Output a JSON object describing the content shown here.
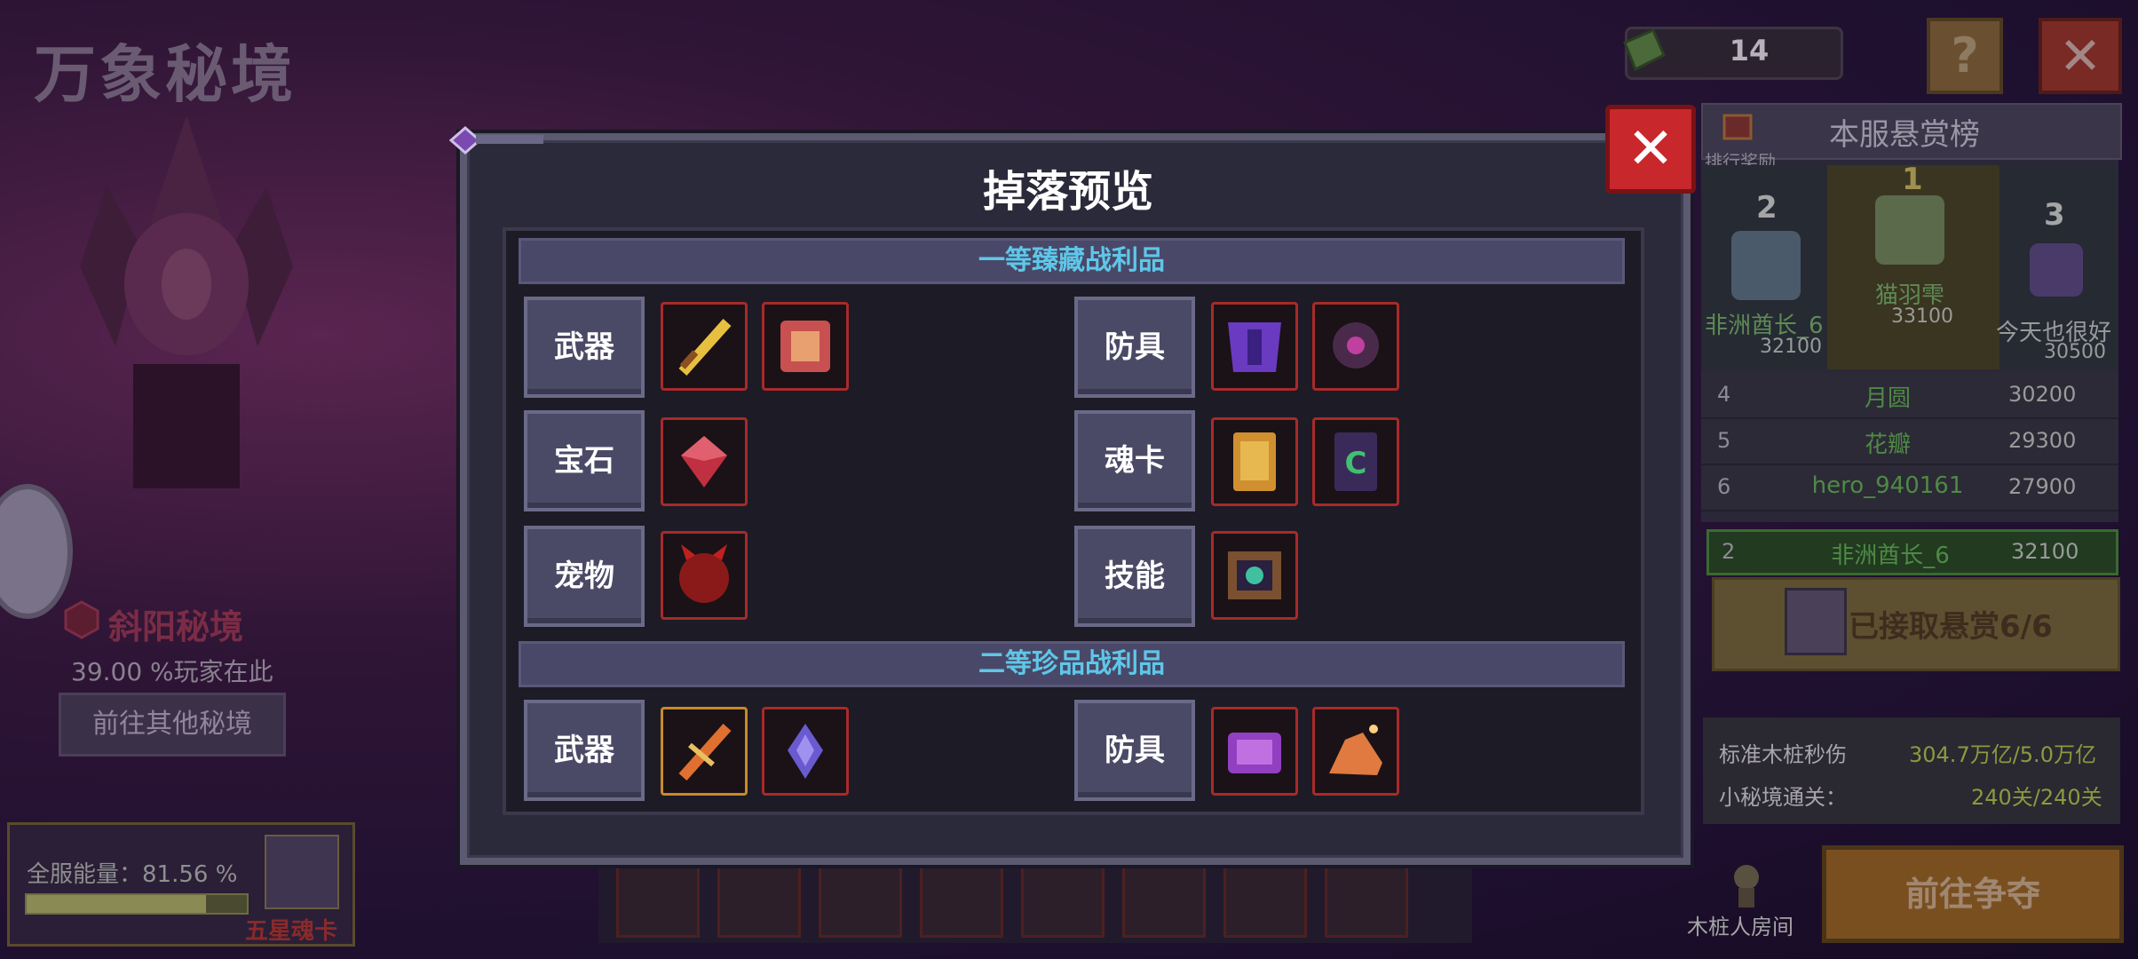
{
  "background": {
    "title": "万象秘境",
    "realm_name": "斜阳秘境",
    "realm_pct": "39.00 %玩家在此",
    "go_other_label": "前往其他秘境",
    "energy_label": "全服能量：81.56 %",
    "energy_fraction": 0.8156,
    "five_star_label": "五星魂卡"
  },
  "hud": {
    "currency_value": "14",
    "help_label": "?",
    "close_label": "✕"
  },
  "leaderboard": {
    "title": "本服悬赏榜",
    "rank_reward": "排行奖励",
    "podium": [
      {
        "rank": "2",
        "name": "非洲酋长_6",
        "score": "32100"
      },
      {
        "rank": "1",
        "name": "猫羽雫",
        "score": "33100"
      },
      {
        "rank": "3",
        "name": "今天也很好",
        "score": "30500"
      }
    ],
    "rows": [
      {
        "rank": "4",
        "name": "月圆",
        "score": "30200"
      },
      {
        "rank": "5",
        "name": "花瓣",
        "score": "29300"
      },
      {
        "rank": "6",
        "name": "hero_940161",
        "score": "27900"
      }
    ],
    "my_row": {
      "rank": "2",
      "name": "非洲酋长_6",
      "score": "32100"
    },
    "bounty_label": "已接取悬赏6/6",
    "stats": [
      {
        "label": "标准木桩秒伤",
        "value": "304.7万亿/5.0万亿"
      },
      {
        "label": "小秘境通关：",
        "value": "240关/240关"
      }
    ],
    "fight_label": "前往争夺",
    "dummy_room_label": "木桩人房间"
  },
  "modal": {
    "title": "掉落预览",
    "close_label": "✕",
    "section1": "一等臻藏战利品",
    "section2": "二等珍品战利品",
    "categories1": [
      {
        "label": "武器",
        "items": [
          "golden-sword-icon",
          "red-chest-armor-icon"
        ]
      },
      {
        "label": "防具",
        "items": [
          "purple-armor-icon",
          "dark-hood-icon"
        ]
      },
      {
        "label": "宝石",
        "items": [
          "ruby-gem-icon"
        ]
      },
      {
        "label": "魂卡",
        "items": [
          "golden-card-icon",
          "green-c-card-icon"
        ]
      },
      {
        "label": "宠物",
        "items": [
          "red-demon-pet-icon"
        ]
      },
      {
        "label": "技能",
        "items": [
          "skill-scroll-icon"
        ]
      }
    ],
    "categories2": [
      {
        "label": "武器",
        "items": [
          "flame-sword-icon",
          "purple-crystal-icon"
        ]
      },
      {
        "label": "防具",
        "items": [
          "purple-chest-icon",
          "orange-ore-icon"
        ]
      }
    ]
  },
  "colors": {
    "accent_section": "#5ec7e9",
    "item_border": "#a82a2a",
    "close_red": "#c8272b"
  }
}
